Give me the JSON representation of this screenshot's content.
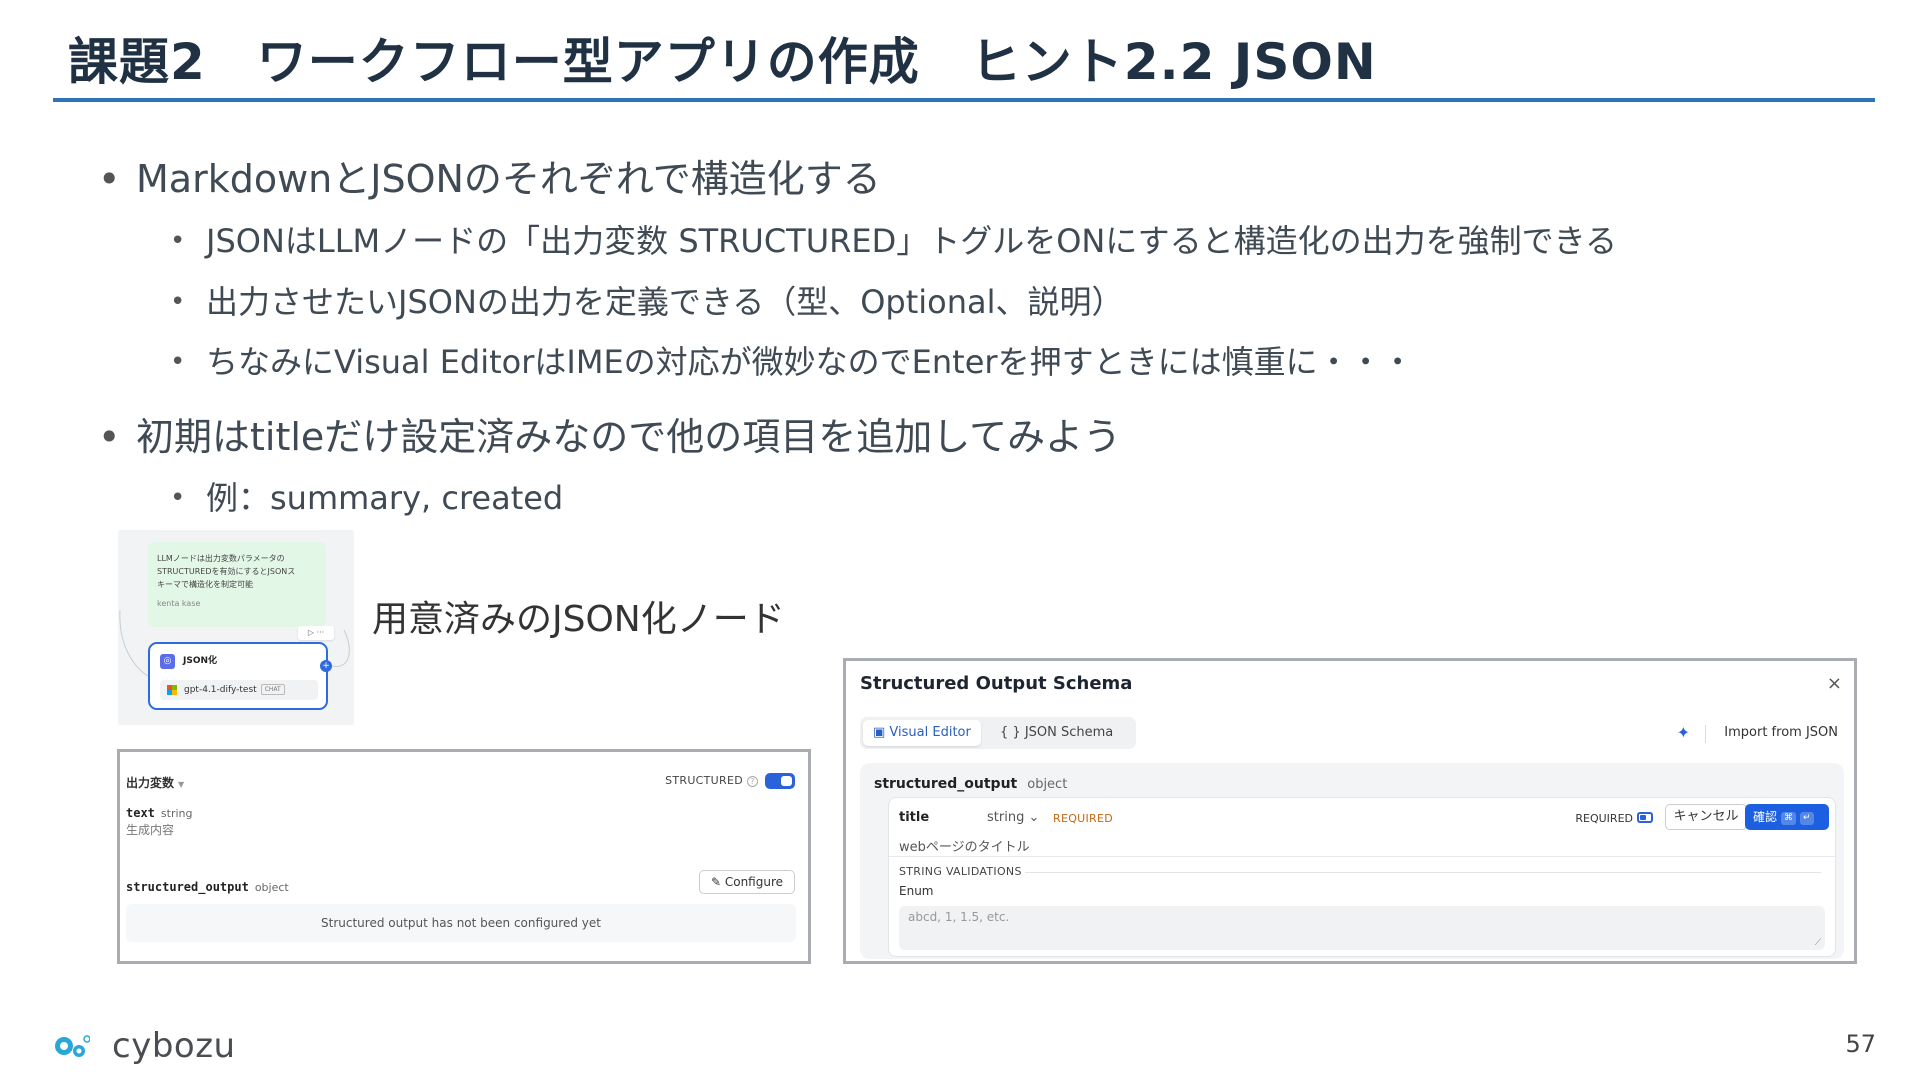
{
  "slide": {
    "title": "課題2　ワークフロー型アプリの作成　ヒント2.2 JSON",
    "bullets": [
      "MarkdownとJSONのそれぞれで構造化する",
      "JSONはLLMノードの「出力変数 STRUCTURED」トグルをONにすると構造化の出力を強制できる",
      "出力させたいJSONの出力を定義できる（型、Optional、説明）",
      "ちなみにVisual EditorはIMEの対応が微妙なのでEnterを押すときには慎重に・・・",
      "初期はtitleだけ設定済みなので他の項目を追加してみよう",
      "例：summary, created"
    ],
    "caption": "用意済みのJSON化ノード",
    "page_number": "57",
    "logo_text": "cybozu"
  },
  "node_thumb": {
    "note_lines": [
      "LLMノードは出力変数パラメータの",
      "STRUCTUREDを有効にするとJSONス",
      "キーマで構造化を制定可能"
    ],
    "note_author": "kenta kase",
    "more": "▷ ···",
    "node_title": "JSON化",
    "model": "gpt-4.1-dify-test",
    "model_badge": "CHAT"
  },
  "output_panel": {
    "label": "出力変数",
    "structured_label": "STRUCTURED",
    "structured_on": true,
    "var1_name": "text",
    "var1_type": "string",
    "var1_desc": "生成内容",
    "var2_name": "structured_output",
    "var2_type": "object",
    "configure": "Configure",
    "empty_msg": "Structured output has not been configured yet"
  },
  "schema_panel": {
    "title": "Structured Output Schema",
    "close": "×",
    "tab_visual": "Visual Editor",
    "tab_json": "JSON Schema",
    "import": "Import from JSON",
    "root_name": "structured_output",
    "root_type": "object",
    "field_name": "title",
    "field_type": "string",
    "field_required_tag": "REQUIRED",
    "required_toggle_label": "REQUIRED",
    "cancel": "キャンセル",
    "confirm": "確認",
    "field_desc": "webページのタイトル",
    "validations_label": "STRING VALIDATIONS",
    "enum_label": "Enum",
    "enum_placeholder": "abcd, 1, 1.5, etc."
  },
  "colors": {
    "title_rule": "#2d74b8",
    "accent_blue": "#2a63d9",
    "required_orange": "#c2690e"
  }
}
